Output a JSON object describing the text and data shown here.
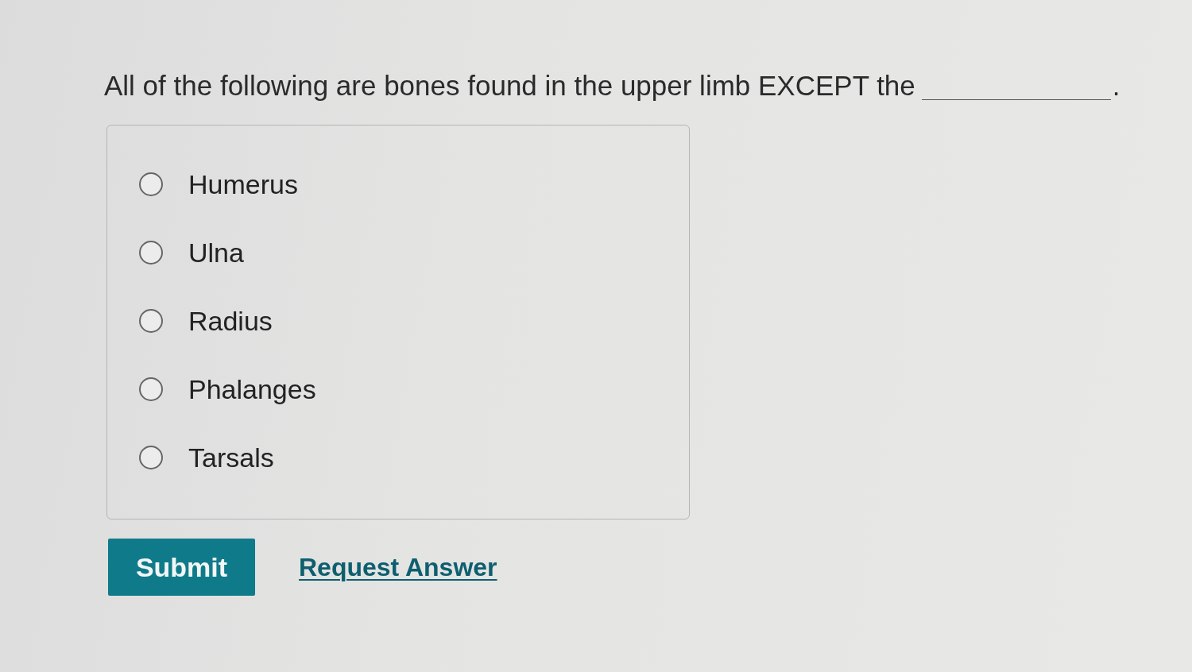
{
  "question": {
    "text": "All of the following are bones found in the upper limb EXCEPT the",
    "ending": "."
  },
  "options": [
    {
      "label": "Humerus",
      "selected": false
    },
    {
      "label": "Ulna",
      "selected": false
    },
    {
      "label": "Radius",
      "selected": false
    },
    {
      "label": "Phalanges",
      "selected": false
    },
    {
      "label": "Tarsals",
      "selected": false
    }
  ],
  "actions": [
    {
      "kind": "button",
      "label": "Submit"
    },
    {
      "kind": "link",
      "label": "Request Answer"
    }
  ]
}
